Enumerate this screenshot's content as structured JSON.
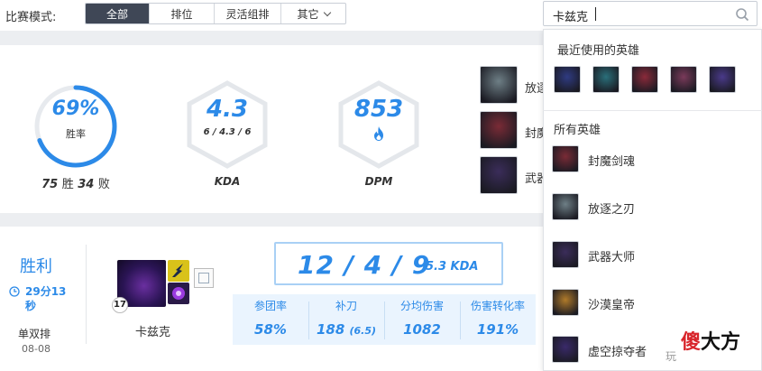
{
  "filter": {
    "label": "比赛模式:",
    "options": [
      "全部",
      "排位",
      "灵活组排",
      "其它"
    ],
    "active_index": 0
  },
  "search": {
    "value": "卡兹克",
    "icon": "search-icon"
  },
  "summary": {
    "winrate": {
      "value": "69%",
      "label": "胜率",
      "fraction": 0.69
    },
    "record": {
      "wins": "75",
      "wins_label": "胜",
      "losses": "34",
      "losses_label": "败"
    },
    "kda": {
      "value": "4.3",
      "detail": "6 / 4.3 / 6",
      "label": "KDA"
    },
    "dpm": {
      "value": "853",
      "label": "DPM",
      "icon": "fire-icon"
    },
    "recent_champs": [
      {
        "label": "放逐",
        "color": "#6e7f86"
      },
      {
        "label": "封魔",
        "color": "#7a2b36"
      },
      {
        "label": "武器",
        "color": "#3b2d5a"
      }
    ]
  },
  "match": {
    "result": "胜利",
    "duration": "29分13秒",
    "queue": "单双排",
    "date": "08-08",
    "champion": "卡兹克",
    "level": "17",
    "score": "12 / 4 / 9",
    "kda": "5.3 KDA",
    "stats": [
      {
        "label": "参团率",
        "value": "58%"
      },
      {
        "label": "补刀",
        "value": "188",
        "extra": "(6.5)"
      },
      {
        "label": "分均伤害",
        "value": "1082"
      },
      {
        "label": "伤害转化率",
        "value": "191%"
      }
    ]
  },
  "dropdown": {
    "recent_title": "最近使用的英雄",
    "recent_colors": [
      "#2f3b82",
      "#2a6f7a",
      "#8a2a3a",
      "#7a3a5a",
      "#4a3a8a"
    ],
    "all_title": "所有英雄",
    "heroes": [
      {
        "name": "封魔剑魂",
        "color": "#7a2b36"
      },
      {
        "name": "放逐之刃",
        "color": "#6e7f86"
      },
      {
        "name": "武器大师",
        "color": "#3b2d5a"
      },
      {
        "name": "沙漠皇帝",
        "color": "#b07a2a"
      },
      {
        "name": "虚空掠夺者",
        "color": "#3a2a6a"
      }
    ]
  },
  "watermark": {
    "small": "玩",
    "brand_a": "傻",
    "brand_b": "大方"
  }
}
